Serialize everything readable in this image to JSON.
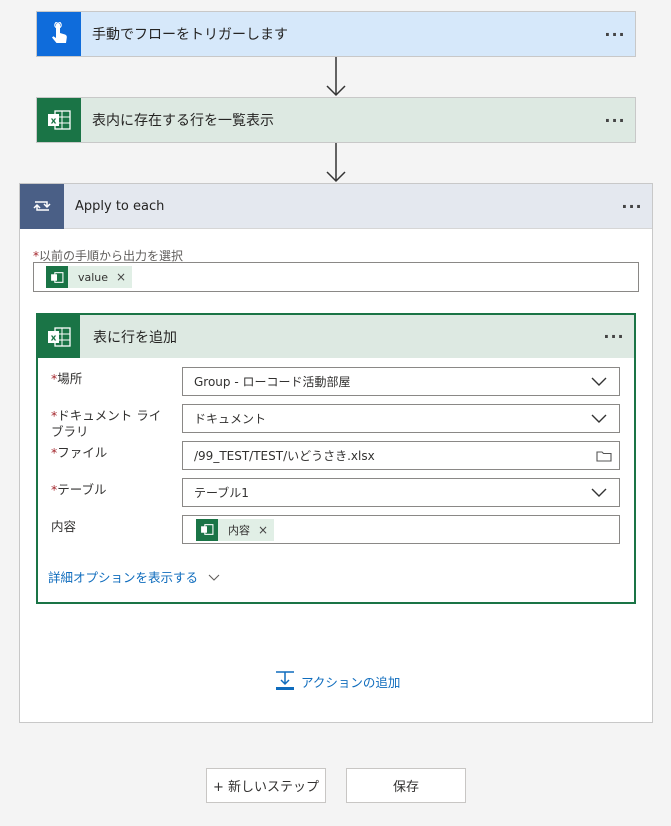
{
  "trigger": {
    "title": "手動でフローをトリガーします",
    "more": "···"
  },
  "list_rows": {
    "title": "表内に存在する行を一覧表示",
    "more": "···"
  },
  "apply_to_each": {
    "title": "Apply to each",
    "more": "···",
    "required_mark": "*",
    "prev_output_label": "以前の手順から出力を選択",
    "prev_output_token": "value",
    "token_remove": "×",
    "add_row": {
      "title": "表に行を追加",
      "more": "···",
      "fields": [
        {
          "label": "場所",
          "required": "*",
          "value": "Group - ローコード活動部屋"
        },
        {
          "label": "ドキュメント ライブラリ",
          "required": "*",
          "value": "ドキュメント"
        },
        {
          "label": "ファイル",
          "required": "*",
          "value": "/99_TEST/TEST/いどうさき.xlsx"
        },
        {
          "label": "テーブル",
          "required": "*",
          "value": "テーブル1"
        },
        {
          "label": "内容",
          "required": "",
          "token": "内容"
        }
      ],
      "advanced_options": "詳細オプションを表示する"
    },
    "add_action": "アクションの追加"
  },
  "buttons": {
    "new_step": "+ 新しいステップ",
    "save": "保存"
  },
  "colors": {
    "excel_green": "#1a7446",
    "trigger_blue": "#0f6cdb",
    "loop_blue": "#4a5f86",
    "link_blue": "#0f6cbd"
  }
}
